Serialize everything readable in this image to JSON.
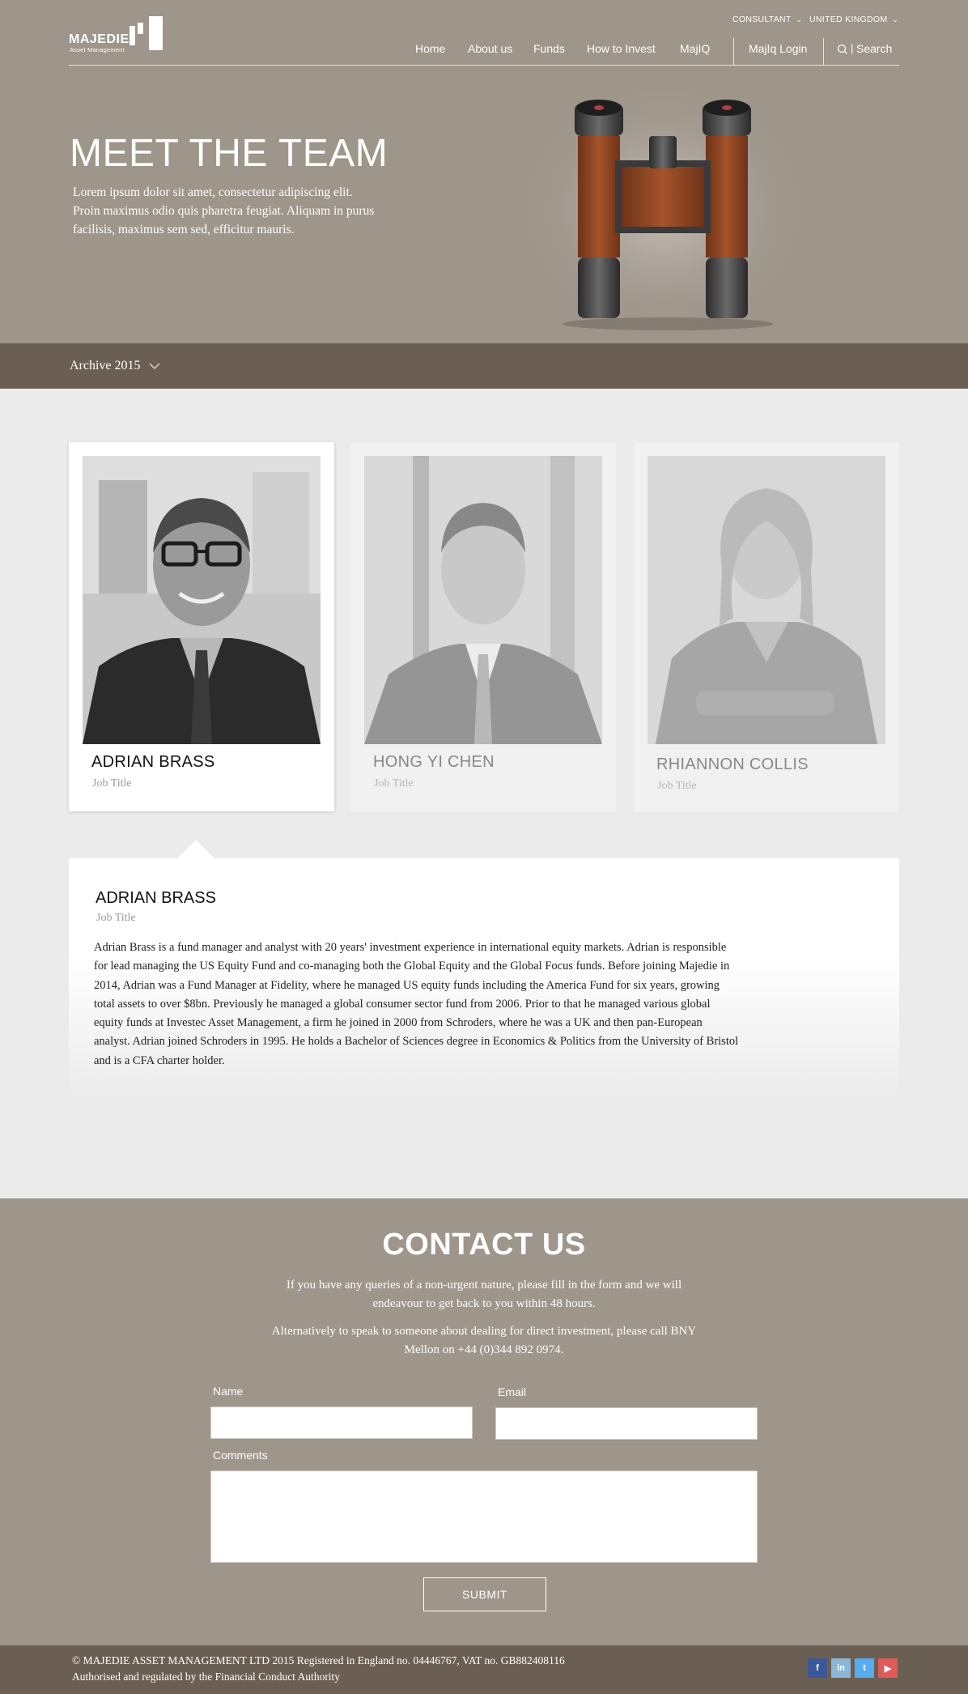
{
  "brand": {
    "name": "MAJEDIE",
    "sub": "Asset Management"
  },
  "utility": {
    "audience": "CONSULTANT",
    "region": "UNITED KINGDOM"
  },
  "nav": {
    "items": [
      "Home",
      "About us",
      "Funds",
      "How to Invest",
      "MajIQ"
    ],
    "login": "MajIq Login",
    "search": "Search"
  },
  "hero": {
    "title": "MEET THE TEAM",
    "text": "Lorem ipsum dolor sit amet, consectetur adipiscing elit. Proin maximus odio quis pharetra feugiat. Aliquam in purus facilisis, maximus sem sed, efficitur mauris."
  },
  "archive": {
    "label": "Archive 2015"
  },
  "team": [
    {
      "name": "ADRIAN BRASS",
      "job": "Job Title"
    },
    {
      "name": "HONG YI CHEN",
      "job": "Job Title"
    },
    {
      "name": "RHIANNON COLLIS",
      "job": "Job Title"
    }
  ],
  "detail": {
    "name": "ADRIAN BRASS",
    "job": "Job Title",
    "bio": "Adrian Brass is a fund manager and analyst with 20 years' investment experience in international equity markets. Adrian is responsible for lead managing the US Equity Fund and co-managing both the Global Equity and the Global Focus funds. Before joining Majedie in 2014, Adrian was a Fund Manager at Fidelity, where he managed US equity funds including the America Fund for six years, growing total assets to over $8bn. Previously he managed a global consumer sector fund from 2006. Prior to that he managed various global equity funds at Investec Asset Management, a firm he joined in 2000 from Schroders, where he was a UK and then pan-European analyst. Adrian joined Schroders in 1995. He holds a Bachelor of Sciences degree in Economics & Politics from the University of Bristol and is a CFA charter holder."
  },
  "contact": {
    "title": "CONTACT US",
    "p1": "If you have any queries of a non-urgent nature, please fill in the form and we will endeavour to get back to you within 48 hours.",
    "p2": "Alternatively to speak to someone about dealing for direct investment, please call BNY Mellon on +44 (0)344 892 0974.",
    "name_label": "Name",
    "email_label": "Email",
    "comments_label": "Comments",
    "name_value": "",
    "email_value": "",
    "comments_value": "",
    "submit": "SUBMIT"
  },
  "footer": {
    "line1": "© MAJEDIE ASSET MANAGEMENT LTD 2015 Registered in England no. 04446767, VAT no. GB882408116",
    "line2": "Authorised and regulated by the Financial Conduct Authority"
  },
  "social": {
    "icons": [
      "facebook-icon",
      "linkedin-icon",
      "twitter-icon",
      "youtube-icon"
    ],
    "colors": [
      "#3b5998",
      "#8ab7d6",
      "#55acee",
      "#e05a5a"
    ],
    "glyphs": [
      "f",
      "in",
      "t",
      "▶"
    ]
  },
  "colors": {
    "hero_bg": "#9e958b",
    "dark_bar": "#6b5f53",
    "page_bg": "#ebebeb"
  }
}
